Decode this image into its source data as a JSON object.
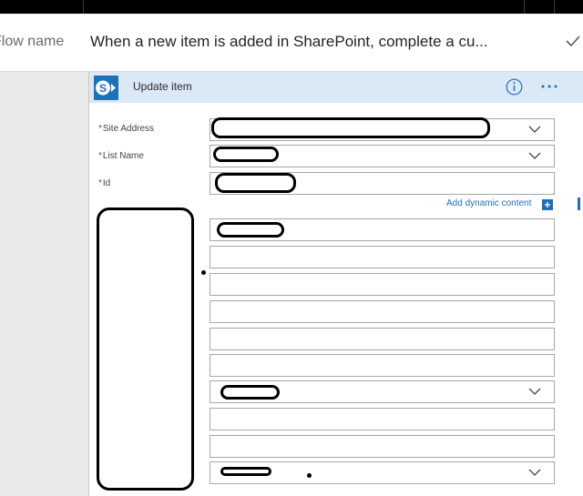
{
  "header": {
    "flow_name_label": "Flow name",
    "flow_title": "When a new item is added in SharePoint, complete a cu..."
  },
  "card": {
    "title": "Update item",
    "fields": [
      {
        "required": "*",
        "label": "Site Address",
        "value": "",
        "dropdown": true
      },
      {
        "required": "*",
        "label": "List Name",
        "value": "",
        "dropdown": true
      },
      {
        "required": "*",
        "label": "Id",
        "value": "",
        "dropdown": false
      }
    ],
    "add_dynamic_content": "Add dynamic content"
  },
  "icons": {
    "sharepoint": "sharepoint-icon",
    "info": "info-icon",
    "more": "more-icon",
    "check": "check-icon",
    "chevron": "chevron-down-icon",
    "add": "add-icon"
  },
  "colors": {
    "accent": "#1b72b9",
    "card_header": "#dbe8f5",
    "link": "#1b6fbf"
  }
}
